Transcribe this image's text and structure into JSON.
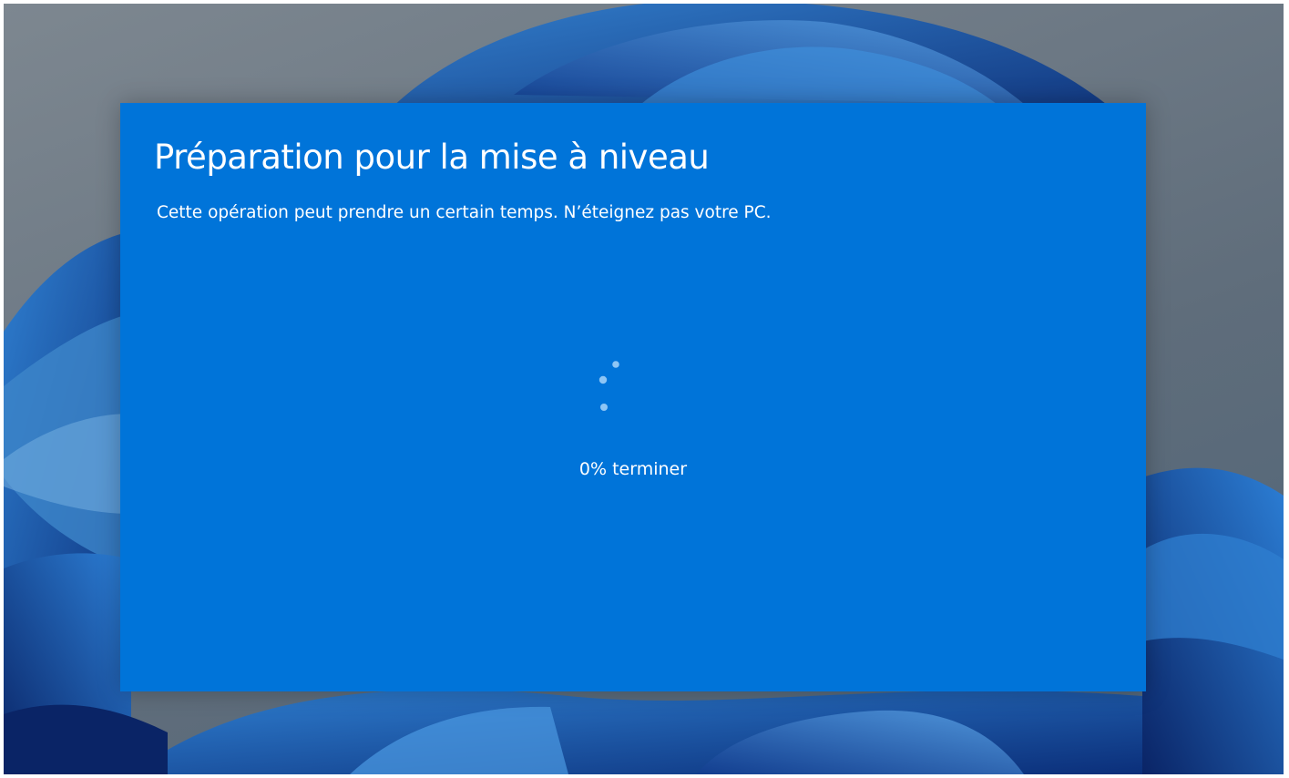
{
  "setup_dialog": {
    "title": "Préparation pour la mise à niveau",
    "subtitle": "Cette opération peut prendre un certain temps. N’éteignez pas votre PC.",
    "progress_percent": 0,
    "progress_text": "0% terminer",
    "spinner_icon": "loading-dots-icon"
  },
  "colors": {
    "dialog_background": "#0074d9",
    "text": "#ffffff",
    "spinner_dot": "#8ec6f5"
  }
}
